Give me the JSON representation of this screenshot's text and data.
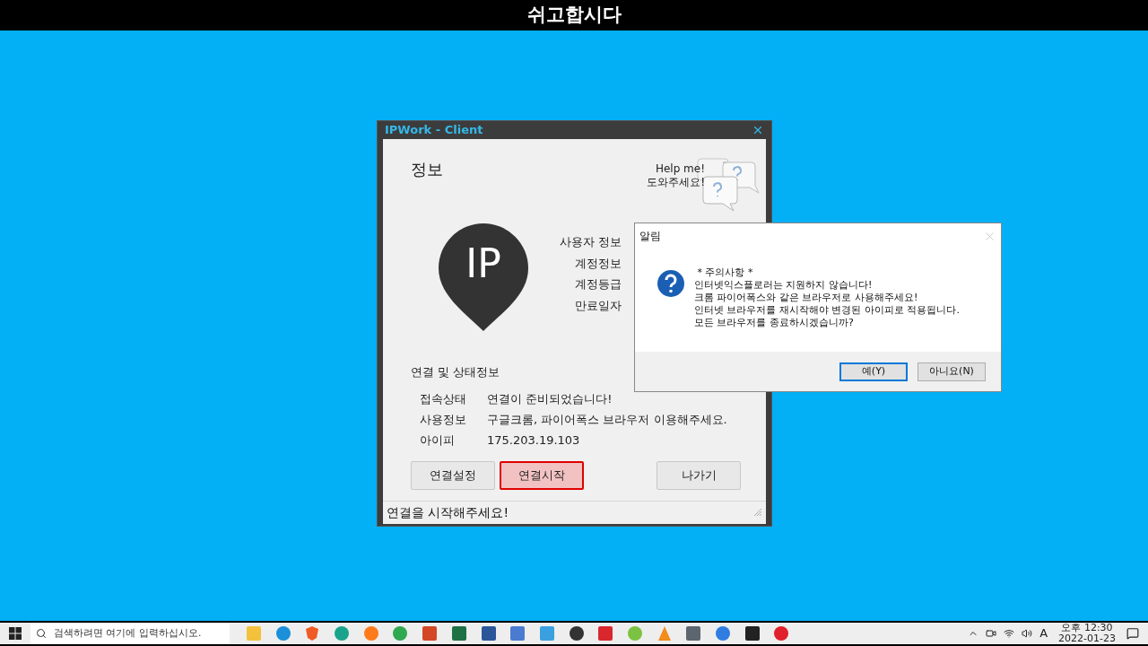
{
  "banner": {
    "title": "쉬고합시다"
  },
  "window": {
    "title": "IPWork - Client",
    "section": "정보",
    "help": {
      "line1": "Help me!",
      "line2": "도와주세요!"
    },
    "logo": "IP",
    "user_info": {
      "heading": "사용자 정보",
      "fields": [
        "계정정보",
        "계정등급",
        "만료일자"
      ]
    },
    "status": {
      "heading": "연결 및 상태정보",
      "rows": [
        {
          "label": "접속상태",
          "value": "연결이 준비되었습니다!"
        },
        {
          "label": "사용정보",
          "value": "구글크롬, 파이어폭스 브라우저 이용해주세요."
        },
        {
          "label": "아이피",
          "value": "175.203.19.103"
        }
      ]
    },
    "buttons": [
      {
        "label": "연결설정",
        "highlighted": false
      },
      {
        "label": "연결시작",
        "highlighted": true
      },
      {
        "label": "나가기",
        "highlighted": false
      }
    ],
    "status_bar": "연결을 시작해주세요!"
  },
  "dialog": {
    "title": "알림",
    "lines": [
      " * 주의사항 *",
      "인터넷익스플로러는 지원하지 않습니다!",
      "크롬 파이어폭스와 같은 브라우저로 사용해주세요!",
      "인터넷 브라우저를 재시작해야 변경된 아이피로 적용됩니다.",
      "모든 브라우저를 종료하시겠습니까?"
    ],
    "buttons": [
      {
        "label": "예(Y)",
        "selected": true
      },
      {
        "label": "아니요(N)",
        "selected": false
      }
    ]
  },
  "taskbar": {
    "search_placeholder": "검색하려면 여기에 입력하십시오.",
    "ime": "A",
    "time": "오후 12:30",
    "date": "2022-01-23"
  }
}
